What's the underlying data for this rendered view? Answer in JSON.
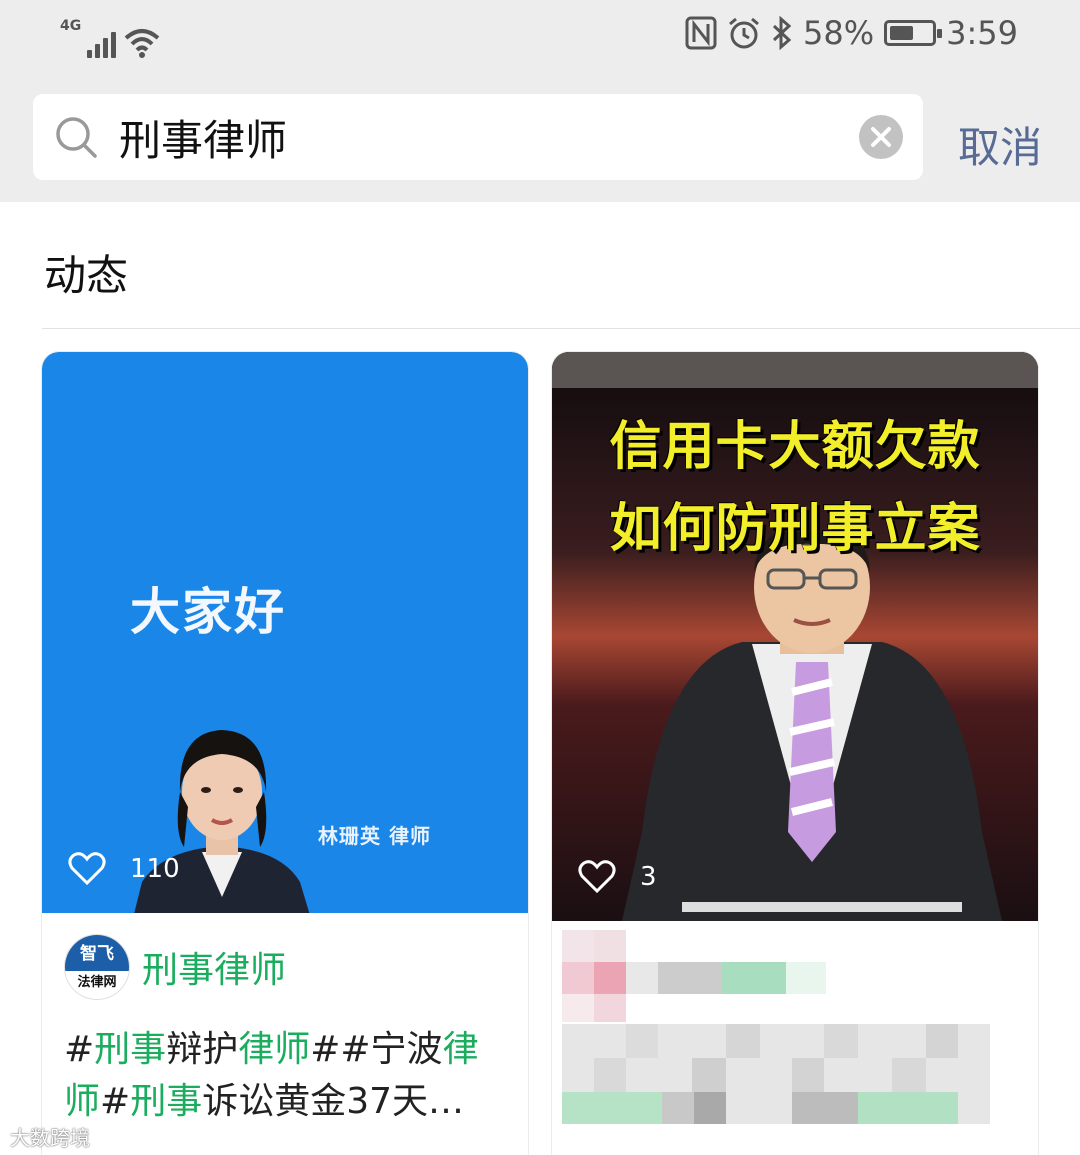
{
  "status_bar": {
    "network": "4G",
    "battery": "58%",
    "time": "3:59",
    "icons": [
      "signal-icon",
      "wifi-icon",
      "nfc-icon",
      "alarm-icon",
      "bluetooth-icon",
      "battery-icon"
    ],
    "battery_level": 0.58
  },
  "search": {
    "query": "刑事律师",
    "cancel_label": "取消"
  },
  "section": {
    "title": "动态"
  },
  "cards": [
    {
      "thumb_text": "大家好",
      "lawyer_caption": "林珊英  律师",
      "likes": "110",
      "avatar_top": "智飞",
      "avatar_bottom": "法律网",
      "author": "刑事律师",
      "desc_parts": [
        "#",
        "刑事",
        "辩护",
        "律师",
        "##宁波",
        "律",
        "师",
        "#",
        "刑事",
        "诉讼黄金37天…"
      ]
    },
    {
      "headline_1": "信用卡大额欠款",
      "headline_2": "如何防刑事立案",
      "likes": "3"
    }
  ],
  "watermark": "大数跨境",
  "colors": {
    "accent_green": "#1aad5e",
    "link_blue": "#576b95",
    "header_bg": "#ededed",
    "thumb_blue": "#1a86e8",
    "headline_yellow": "#f3ee2a"
  }
}
